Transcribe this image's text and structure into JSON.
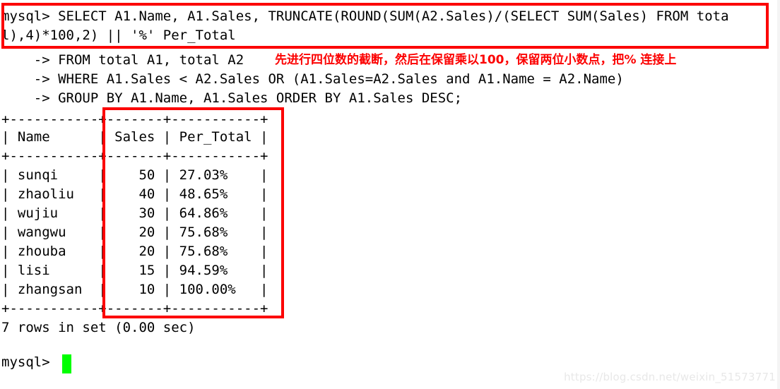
{
  "terminal": {
    "prompt": "mysql>",
    "continuation": "    ->",
    "lines": [
      "mysql> SELECT A1.Name, A1.Sales, TRUNCATE(ROUND(SUM(A2.Sales)/(SELECT SUM(Sales) FROM tota",
      "l),4)*100,2) || '%' Per_Total",
      "    -> FROM total A1, total A2",
      "    -> WHERE A1.Sales < A2.Sales OR (A1.Sales=A2.Sales and A1.Name = A2.Name)",
      "    -> GROUP BY A1.Name, A1.Sales ORDER BY A1.Sales DESC;",
      "+-----------+-------+-----------+",
      "| Name      | Sales | Per_Total |",
      "+-----------+-------+-----------+",
      "| sunqi     |    50 | 27.03%    |",
      "| zhaoliu   |    40 | 48.65%    |",
      "| wujiu     |    30 | 64.86%    |",
      "| wangwu    |    20 | 75.68%    |",
      "| zhouba    |    20 | 75.68%    |",
      "| lisi      |    15 | 94.59%    |",
      "| zhangsan  |    10 | 100.00%   |",
      "+-----------+-------+-----------+",
      "7 rows in set (0.00 sec)",
      "mysql> "
    ],
    "result_summary": "7 rows in set (0.00 sec)",
    "final_prompt": "mysql> "
  },
  "result_table": {
    "columns": [
      "Name",
      "Sales",
      "Per_Total"
    ],
    "rows": [
      [
        "sunqi",
        "50",
        "27.03%"
      ],
      [
        "zhaoliu",
        "40",
        "48.65%"
      ],
      [
        "wujiu",
        "30",
        "64.86%"
      ],
      [
        "wangwu",
        "20",
        "75.68%"
      ],
      [
        "zhouba",
        "20",
        "75.68%"
      ],
      [
        "lisi",
        "15",
        "94.59%"
      ],
      [
        "zhangsan",
        "10",
        "100.00%"
      ]
    ],
    "row_count": 7,
    "elapsed": "0.00 sec"
  },
  "annotations": {
    "chinese_note": "先进行四位数的截断，然后在保留乘以100，保留两位小数点，把% 连接上",
    "highlight_color": "#fc0000",
    "boxes": [
      {
        "name": "query-statement-box"
      },
      {
        "name": "result-table-box"
      }
    ]
  },
  "cursor": {
    "color": "#00ff00"
  },
  "watermark": {
    "text": "https://blog.csdn.net/weixin_51573771",
    "color": "#e8e8e8"
  }
}
